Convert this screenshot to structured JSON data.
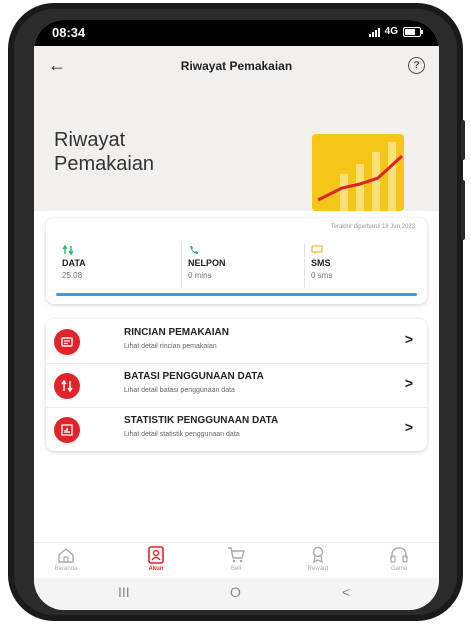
{
  "status_bar": {
    "time": "08:34",
    "network": "4G"
  },
  "app_bar": {
    "title": "Riwayat Pemakaian",
    "back_icon": "arrow-left-icon",
    "help_label": "?"
  },
  "hero": {
    "title": "Riwayat Pemakaian",
    "illustration": "chart-growth-icon"
  },
  "usage": {
    "updated_text": "Terakhir diperbarui 18 Jun 2023",
    "bar_progress": 1.0,
    "items": [
      {
        "label": "DATA",
        "value": "25.08",
        "icon": "data-arrows-icon",
        "color": "#2bb673"
      },
      {
        "label": "NELPON",
        "value": "0 mins",
        "icon": "phone-icon",
        "color": "#2bb673"
      },
      {
        "label": "SMS",
        "value": "0 sms",
        "icon": "message-icon",
        "color": "#e8c13a"
      }
    ]
  },
  "menu": {
    "items": [
      {
        "title": "RINCIAN PEMAKAIAN",
        "subtitle": "Lihat detail rincian pemakaian",
        "icon": "receipt-icon"
      },
      {
        "title": "BATASI PENGGUNAAN DATA",
        "subtitle": "Lihat detail batasi penggunaan data",
        "icon": "limit-arrows-icon"
      },
      {
        "title": "STATISTIK PENGGUNAAN DATA",
        "subtitle": "Lihat detail statistik penggunaan data",
        "icon": "bar-chart-icon"
      }
    ],
    "chevron": ">"
  },
  "bottom_nav": {
    "items": [
      {
        "label": "Beranda",
        "icon": "home-icon",
        "active": false
      },
      {
        "label": "Akun",
        "icon": "account-icon",
        "active": true
      },
      {
        "label": "Beli",
        "icon": "cart-icon",
        "active": false
      },
      {
        "label": "Reward",
        "icon": "trophy-icon",
        "active": false
      },
      {
        "label": "Game",
        "icon": "headset-icon",
        "active": false
      }
    ]
  },
  "system_nav": {
    "recents": "III",
    "home": "O",
    "back": "<"
  },
  "colors": {
    "accent": "#e0242a",
    "bar": "#25a8d8",
    "hero_bg": "#f2f0ef",
    "hero_tile": "#f5c518"
  }
}
